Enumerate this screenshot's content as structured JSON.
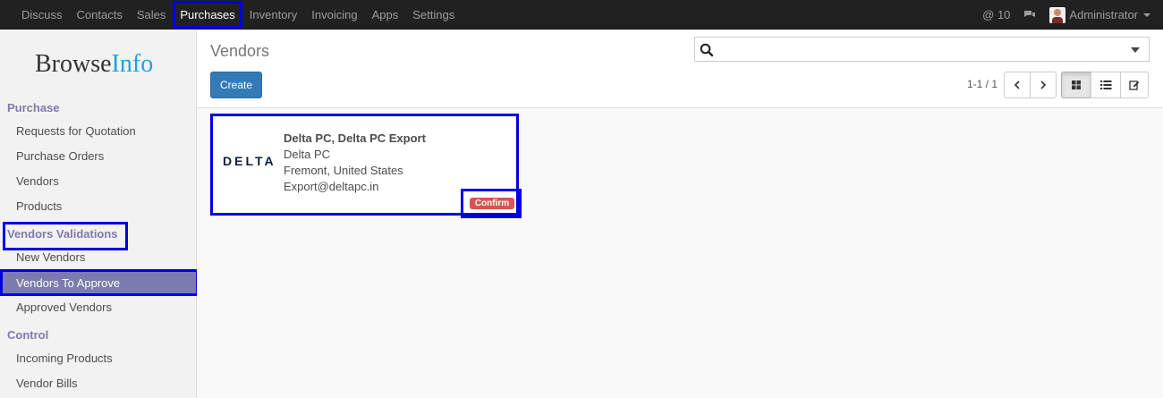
{
  "topbar": {
    "menu": [
      "Discuss",
      "Contacts",
      "Sales",
      "Purchases",
      "Inventory",
      "Invoicing",
      "Apps",
      "Settings"
    ],
    "active": "Purchases",
    "mentions": "@ 10",
    "user": "Administrator"
  },
  "sidebar": {
    "logo_main": "Browse",
    "logo_accent": "Info",
    "purchase_head": "Purchase",
    "purchase_items": [
      "Requests for Quotation",
      "Purchase Orders",
      "Vendors",
      "Products"
    ],
    "validations_head": "Vendors Validations",
    "validations_items": [
      "New Vendors",
      "Vendors To Approve",
      "Approved Vendors"
    ],
    "control_head": "Control",
    "control_items": [
      "Incoming Products",
      "Vendor Bills"
    ]
  },
  "control_panel": {
    "breadcrumb": "Vendors",
    "create_label": "Create",
    "search_placeholder": "",
    "pager": "1-1 / 1"
  },
  "card": {
    "logo_text": "DELTA",
    "title": "Delta PC, Delta PC Export",
    "company": "Delta PC",
    "location": "Fremont, United States",
    "email": "Export@deltapc.in",
    "status": "Confirm"
  },
  "colors": {
    "navbar": "#212121",
    "accent": "#7c7bad",
    "primary": "#337ab7",
    "highlight": "#0000e0",
    "status_red": "#d9534f"
  }
}
